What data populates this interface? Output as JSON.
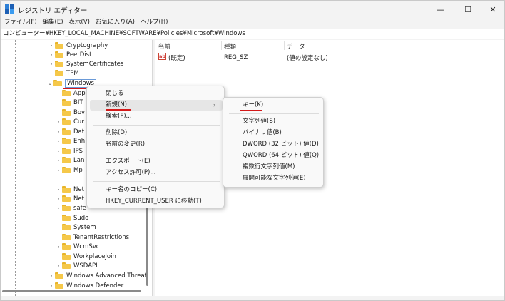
{
  "window": {
    "title": "レジストリ エディター",
    "min_glyph": "—",
    "max_glyph": "☐",
    "close_glyph": "✕"
  },
  "menubar": [
    "ファイル(F)",
    "編集(E)",
    "表示(V)",
    "お気に入り(A)",
    "ヘルプ(H)"
  ],
  "address": "コンピューター¥HKEY_LOCAL_MACHINE¥SOFTWARE¥Policies¥Microsoft¥Windows",
  "tree": {
    "top_items": [
      "Cryptography",
      "PeerDist",
      "SystemCertificates",
      "TPM"
    ],
    "selected": "Windows",
    "children_partial": [
      "App",
      "BIT",
      "Bov",
      "Cur",
      "Dat",
      "Enh",
      "IPS",
      "Lan",
      "Mp",
      "Net",
      "Net",
      "safe"
    ],
    "children_full": [
      "Sudo",
      "System",
      "TenantRestrictions",
      "WcmSvc",
      "WorkplaceJoin",
      "WSDAPI"
    ],
    "bottom_items": [
      "Windows Advanced Threat",
      "Windows Defender"
    ],
    "expand_glyph": "›",
    "collapse_glyph": "⌄"
  },
  "list": {
    "headers": {
      "name": "名前",
      "type": "種類",
      "data": "データ"
    },
    "rows": [
      {
        "icon": "ab",
        "name": "(既定)",
        "type": "REG_SZ",
        "data": "(値の設定なし)"
      }
    ]
  },
  "context_menu": {
    "items": [
      "閉じる",
      "新規(N)",
      "検索(F)...",
      "削除(D)",
      "名前の変更(R)",
      "エクスポート(E)",
      "アクセス許可(P)...",
      "キー名のコピー(C)",
      "HKEY_CURRENT_USER に移動(T)"
    ],
    "arrow": "›"
  },
  "submenu": {
    "items": [
      "キー(K)",
      "文字列値(S)",
      "バイナリ値(B)",
      "DWORD (32 ビット) 値(D)",
      "QWORD (64 ビット) 値(Q)",
      "複数行文字列値(M)",
      "展開可能な文字列値(E)"
    ]
  },
  "colors": {
    "accent_underline": "#d31919",
    "folder": "#f5c84a",
    "selection_border": "#6a9ad8"
  }
}
